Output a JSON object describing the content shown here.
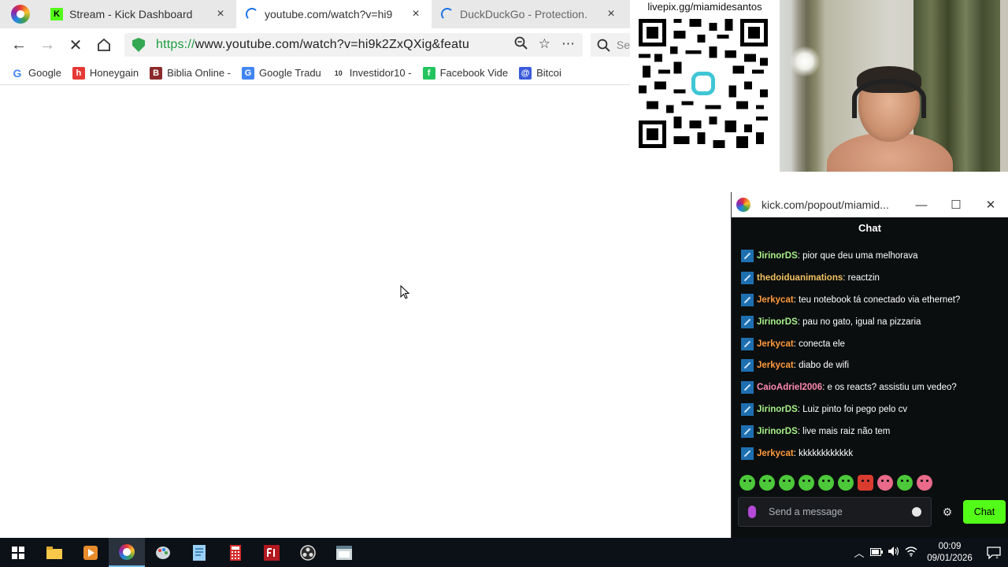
{
  "tabs": [
    {
      "title": "Stream - Kick Dashboard",
      "favicon": "kick-logo-icon",
      "close": "×",
      "active": false
    },
    {
      "title": "youtube.com/watch?v=hi9",
      "favicon": "loading-spinner-icon",
      "close": "×",
      "active": true
    },
    {
      "title": "DuckDuckGo - Protection.",
      "favicon": "loading-spinner-icon",
      "close": "×",
      "active": false
    }
  ],
  "toolbar": {
    "url_scheme": "https://",
    "url_rest": "www.youtube.com/watch?v=hi9k2ZxQXig&featu",
    "search_stub": "Se"
  },
  "bookmarks": [
    {
      "label": "Google",
      "icon": "google-icon",
      "color": "#4285f4",
      "glyph": "G"
    },
    {
      "label": "Honeygain",
      "icon": "honeygain-icon",
      "color": "#e53935",
      "glyph": "h"
    },
    {
      "label": "Biblia Online -",
      "icon": "bible-icon",
      "color": "#8b2a2a",
      "glyph": "B"
    },
    {
      "label": "Google Tradu",
      "icon": "google-translate-icon",
      "color": "#4285f4",
      "glyph": "G"
    },
    {
      "label": "Investidor10 -",
      "icon": "investidor10-icon",
      "color": "#555555",
      "glyph": "10"
    },
    {
      "label": "Facebook Vide",
      "icon": "facebook-icon",
      "color": "#23c45e",
      "glyph": "f"
    },
    {
      "label": "Bitcoi",
      "icon": "bitcoin-icon",
      "color": "#3b5bdb",
      "glyph": "@"
    }
  ],
  "overlay": {
    "qr_caption": "livepix.gg/miamidesantos"
  },
  "chat_window": {
    "title": "kick.com/popout/miamid...",
    "header": "Chat",
    "minimize": "—",
    "maximize": "☐",
    "close": "✕",
    "messages": [
      {
        "user": "JirinorDS",
        "color": "#a7f08a",
        "text": "pior que deu uma melhorava"
      },
      {
        "user": "thedoiduanimations",
        "color": "#f0c060",
        "text": "reactzin"
      },
      {
        "user": "Jerkycat",
        "color": "#ff9a3c",
        "text": "teu notebook tá conectado via ethernet?"
      },
      {
        "user": "JirinorDS",
        "color": "#a7f08a",
        "text": "pau no gato, igual na pizzaria"
      },
      {
        "user": "Jerkycat",
        "color": "#ff9a3c",
        "text": "conecta ele"
      },
      {
        "user": "Jerkycat",
        "color": "#ff9a3c",
        "text": "diabo de wifi"
      },
      {
        "user": "CaioAdriel2006",
        "color": "#ff8ab0",
        "text": "e os reacts? assistiu um vedeo?"
      },
      {
        "user": "JirinorDS",
        "color": "#a7f08a",
        "text": "Luiz pinto foi pego pelo cv"
      },
      {
        "user": "JirinorDS",
        "color": "#a7f08a",
        "text": "live mais raiz não tem"
      },
      {
        "user": "Jerkycat",
        "color": "#ff9a3c",
        "text": "kkkkkkkkkkkk"
      }
    ],
    "input_placeholder": "Send a message",
    "send_label": "Chat",
    "accent": "#53fc18"
  },
  "taskbar": {
    "apps": [
      "windows-start-icon",
      "file-explorer-icon",
      "media-player-icon",
      "browser-icon",
      "paint-icon",
      "notepad-icon",
      "calculator-icon",
      "foxit-icon",
      "obs-icon",
      "app-window-icon"
    ],
    "time": "00:09",
    "date": "09/01/2026"
  }
}
